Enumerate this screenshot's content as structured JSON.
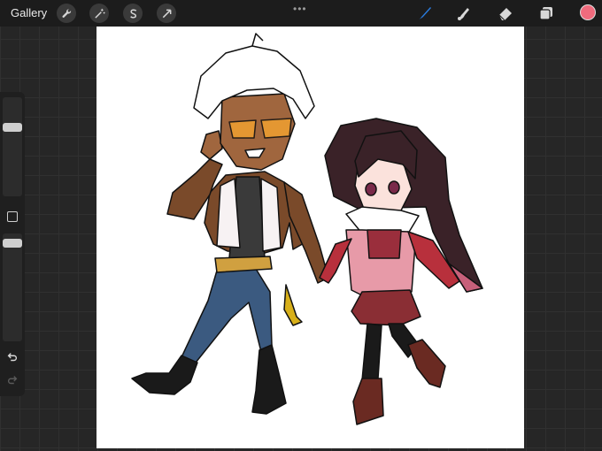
{
  "topbar": {
    "gallery_label": "Gallery",
    "left_tools": [
      {
        "icon": "wrench-icon",
        "name": "actions"
      },
      {
        "icon": "magic-wand-icon",
        "name": "adjustments"
      },
      {
        "icon": "selection-s-icon",
        "name": "selection"
      },
      {
        "icon": "arrow-cursor-icon",
        "name": "transform"
      }
    ],
    "right_tools": [
      {
        "icon": "brush-icon",
        "name": "paint",
        "active": true
      },
      {
        "icon": "smudge-icon",
        "name": "smudge",
        "active": false
      },
      {
        "icon": "eraser-icon",
        "name": "erase",
        "active": false
      },
      {
        "icon": "layers-icon",
        "name": "layers",
        "active": false
      }
    ],
    "current_color": "#f06b7d",
    "active_tool_color": "#2a7de1"
  },
  "sidebar": {
    "brush_size_level": 0.72,
    "opacity_level": 0.95
  },
  "theme": {
    "bar": "#1c1c1c",
    "background": "#262626"
  }
}
